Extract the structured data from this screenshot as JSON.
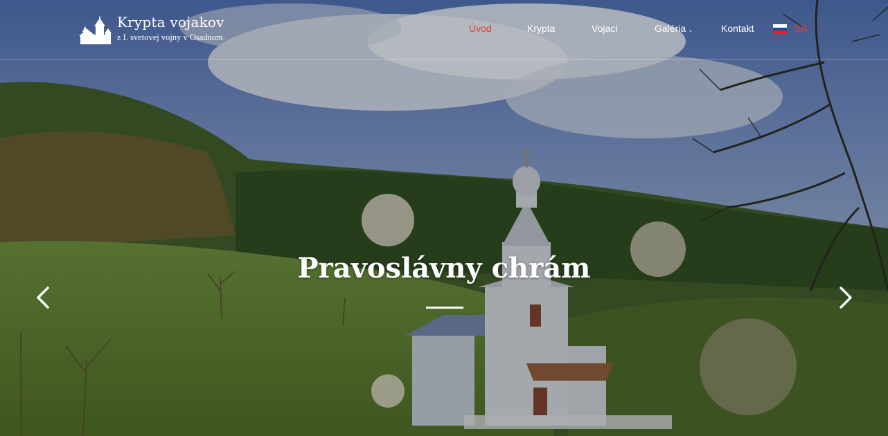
{
  "logo": {
    "title": "Krypta vojakov",
    "subtitle": "z I. svetovej vojny v Osadnom",
    "icon": "church-icon"
  },
  "nav": {
    "items": [
      {
        "label": "Úvod",
        "active": true
      },
      {
        "label": "Krypta",
        "active": false
      },
      {
        "label": "Vojaci",
        "active": false
      },
      {
        "label": "Galéria",
        "active": false,
        "has_dropdown": true
      },
      {
        "label": "Kontakt",
        "active": false
      }
    ],
    "language": {
      "code": "SK",
      "flag": "slovak-flag-icon"
    }
  },
  "slider": {
    "title": "Pravoslávny chrám",
    "prev_icon": "chevron-left-icon",
    "next_icon": "chevron-right-icon"
  },
  "colors": {
    "accent": "#e0413c",
    "text": "#ffffff"
  }
}
